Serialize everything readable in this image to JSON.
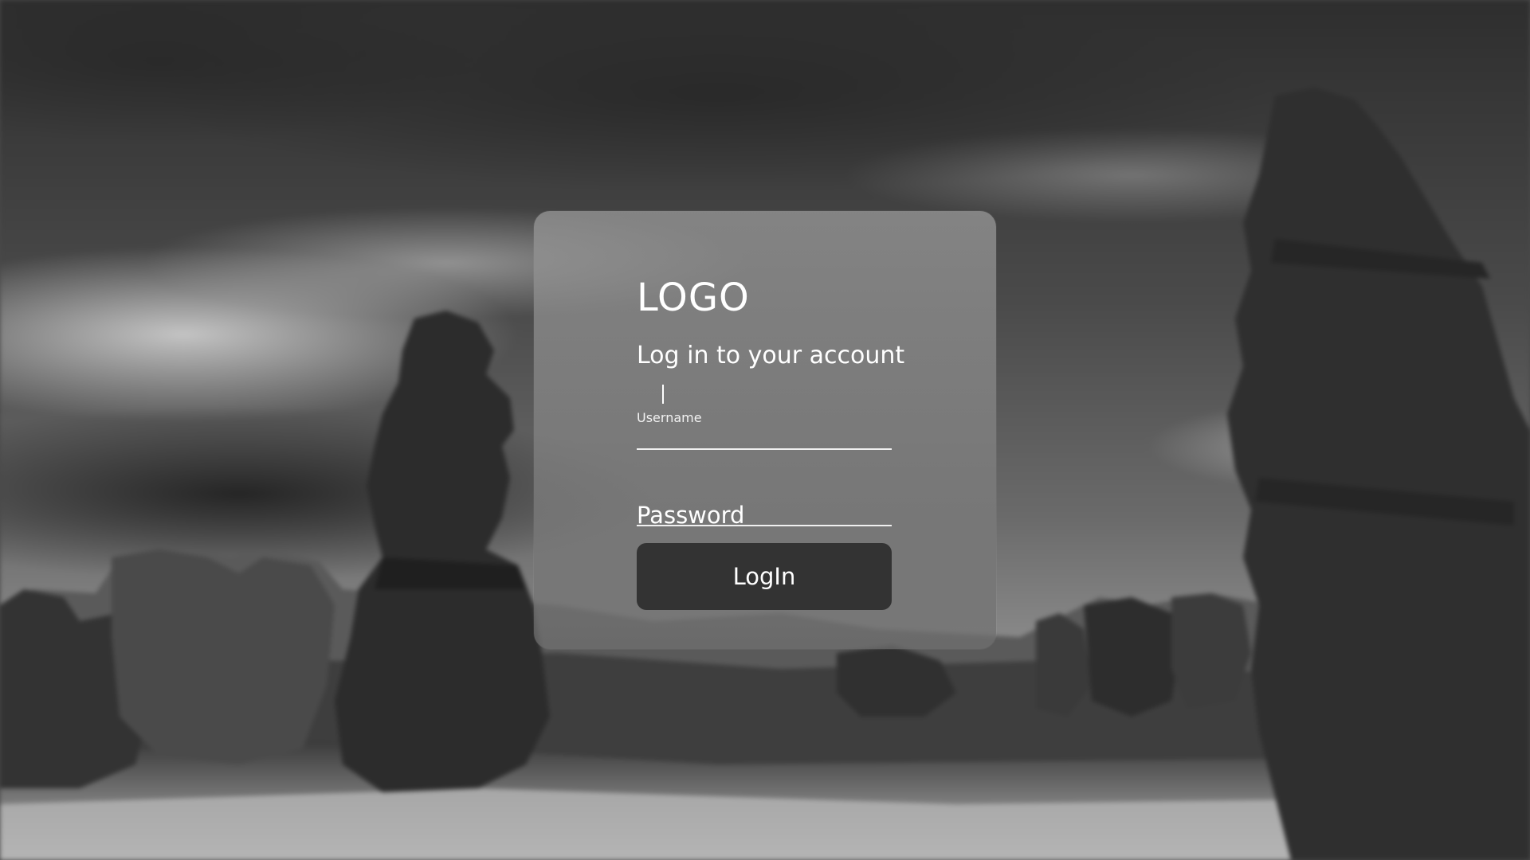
{
  "brand": {
    "logo_text": "LOGO"
  },
  "login_form": {
    "heading": "Log in to your account",
    "username_label": "Username",
    "username_value": "",
    "password_label": "Password",
    "password_value": "",
    "submit_label": "LogIn"
  },
  "colors": {
    "button_bg": "#333333",
    "text": "#ffffff",
    "card_bg": "rgba(140,140,140,0.75)"
  }
}
